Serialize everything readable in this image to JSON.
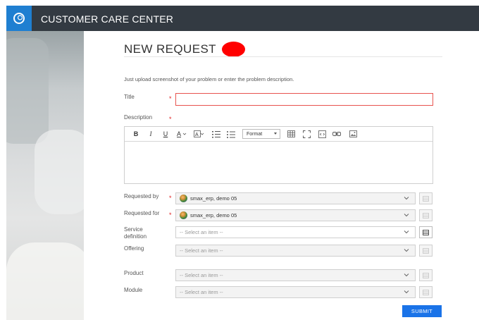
{
  "header": {
    "app_title": "CUSTOMER CARE CENTER",
    "logo_icon": "service-portal-logo-icon"
  },
  "form": {
    "page_title": "NEW REQUEST",
    "intro": "Just upload screenshot of your problem or enter the problem description.",
    "title_label": "Title",
    "title_value": "",
    "description_label": "Description",
    "required_marker": "*",
    "toolbar": {
      "bold": "B",
      "italic": "I",
      "underline": "U",
      "format_label": "Format"
    },
    "requested_by_label": "Requested by",
    "requested_by_value": "smax_erp, demo 05",
    "requested_for_label": "Requested for",
    "requested_for_value": "smax_erp, demo 05",
    "service_label_line1": "Service",
    "service_label_line2": "definition",
    "service_placeholder": "-- Select an item --",
    "offering_label": "Offering",
    "offering_placeholder": "-- Select an item --",
    "product_label": "Product",
    "product_placeholder": "-- Select an item --",
    "module_label": "Module",
    "module_placeholder": "-- Select an item --",
    "submit_label": "SUBMIT"
  },
  "colors": {
    "topbar": "#333a42",
    "logo": "#1f7fd1",
    "required": "#e02020",
    "submit": "#1a73e8",
    "annotation_dot": "#ff0000"
  }
}
